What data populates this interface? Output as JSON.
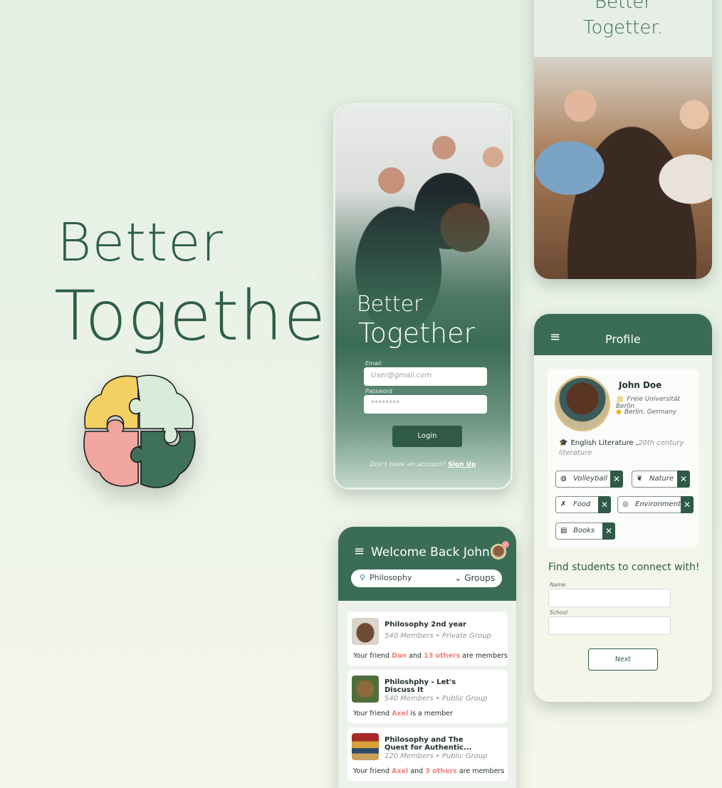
{
  "hero": {
    "line1": "Better",
    "line2": "Together"
  },
  "login": {
    "title_line1": "Better",
    "title_line2": "Together",
    "email_label": "Email",
    "email_placeholder": "User@gmail.com",
    "password_label": "Password",
    "password_value": "********",
    "login_button": "Login",
    "signup_prompt": "Don't have an account?",
    "signup_link": "Sign Up"
  },
  "photo_screen": {
    "line1": "Better",
    "line2": "Togetter."
  },
  "home": {
    "title": "Welcome Back John!",
    "search_value": "Philosophy",
    "filter_label": "Groups",
    "groups": [
      {
        "title": "Philosophy 2nd year",
        "members": "540 Members",
        "privacy": "Private Group",
        "friends_prefix": "Your friend",
        "friend": "Dan",
        "and": "and",
        "others": "13 others",
        "suffix": "are members"
      },
      {
        "title_l1": "Philoshphy - Let's",
        "title_l2": "Discuss It",
        "members": "540 Members",
        "privacy": "Public Group",
        "friends_prefix": "Your friend",
        "friend": "Axel",
        "suffix": "is a member"
      },
      {
        "title_l1": "Philosophy and The",
        "title_l2": "Quest for Authentic...",
        "members": "120 Members",
        "privacy": "Public Group",
        "friends_prefix": "Your friend",
        "friend": "Axel",
        "and": "and",
        "others": "3 others",
        "suffix": "are members"
      }
    ]
  },
  "profile": {
    "title": "Profile",
    "name": "John Doe",
    "university": "Freie Universität Berlin",
    "location": "Berlin, Germany",
    "major": "English Literature ,",
    "major_detail": "20th century literature",
    "interests": [
      "Volleyball",
      "Nature",
      "Food",
      "Environment",
      "Books"
    ],
    "find_title": "Find students to connect with!",
    "name_label": "Name",
    "school_label": "School",
    "next_button": "Next"
  },
  "colors": {
    "primary": "#3b6c56",
    "accent_yellow": "#e9b73d",
    "highlight_pink": "#f0847e",
    "background": "#e3efe2"
  }
}
